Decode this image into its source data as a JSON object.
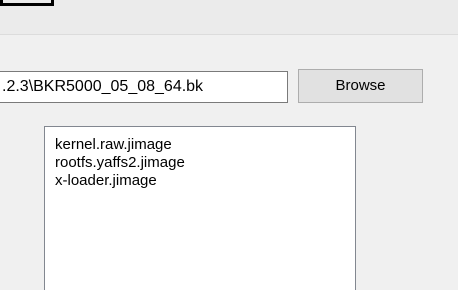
{
  "form": {
    "path_value": ".2.3\\BKR5000_05_08_64.bk",
    "browse_label": "Browse"
  },
  "file_list": {
    "items": [
      {
        "label": "kernel.raw.jimage"
      },
      {
        "label": "rootfs.yaffs2.jimage"
      },
      {
        "label": "x-loader.jimage"
      }
    ]
  }
}
